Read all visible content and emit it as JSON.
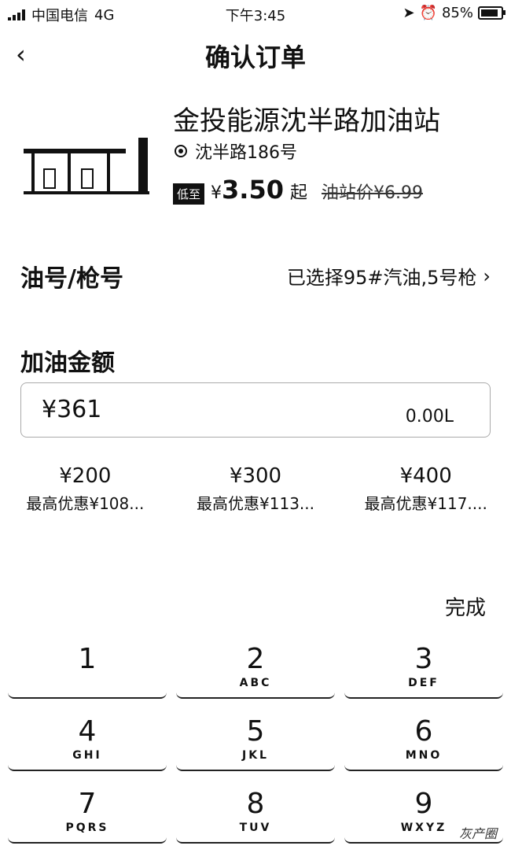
{
  "status": {
    "carrier": "中国电信",
    "network": "4G",
    "time": "下午3:45",
    "battery": "85%"
  },
  "nav": {
    "title": "确认订单",
    "back_glyph": "‹"
  },
  "station": {
    "name": "金投能源沈半路加油站",
    "address": "沈半路186号",
    "tag": "低至",
    "price_currency": "¥",
    "price": "3.50",
    "price_suffix": "起",
    "station_price": "油站价¥6.99"
  },
  "fuel": {
    "label": "油号/枪号",
    "value": "已选择95#汽油,5号枪"
  },
  "amount": {
    "label": "加油金额",
    "input": "¥361",
    "liters": "0.00L"
  },
  "quick_options": [
    {
      "amount": "¥200",
      "discount": "最高优惠¥108..."
    },
    {
      "amount": "¥300",
      "discount": "最高优惠¥113..."
    },
    {
      "amount": "¥400",
      "discount": "最高优惠¥117...."
    }
  ],
  "done_label": "完成",
  "keypad": [
    [
      {
        "num": "1",
        "letters": ""
      },
      {
        "num": "2",
        "letters": "ABC"
      },
      {
        "num": "3",
        "letters": "DEF"
      }
    ],
    [
      {
        "num": "4",
        "letters": "GHI"
      },
      {
        "num": "5",
        "letters": "JKL"
      },
      {
        "num": "6",
        "letters": "MNO"
      }
    ],
    [
      {
        "num": "7",
        "letters": "PQRS"
      },
      {
        "num": "8",
        "letters": "TUV"
      },
      {
        "num": "9",
        "letters": "WXYZ"
      }
    ]
  ],
  "watermark": "灰产圈"
}
